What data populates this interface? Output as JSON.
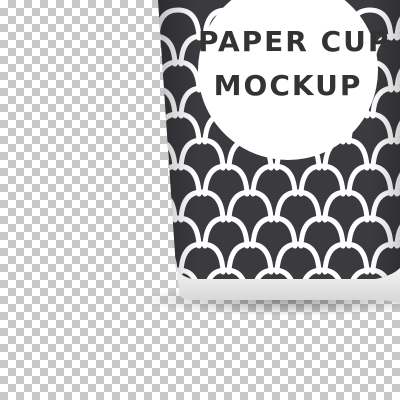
{
  "label": {
    "line1": "PAPER CUP",
    "line2": "MOCKUP"
  },
  "colors": {
    "cup_body": "#3b3a3f",
    "pattern": "#ffffff",
    "label_circle": "#ffffff",
    "label_text": "#333333",
    "cup_rim": "#ececec",
    "checker_light": "#ffffff",
    "checker_dark": "#c8c8c8"
  },
  "pattern": {
    "style": "white scallop arcs",
    "rows": 11
  }
}
